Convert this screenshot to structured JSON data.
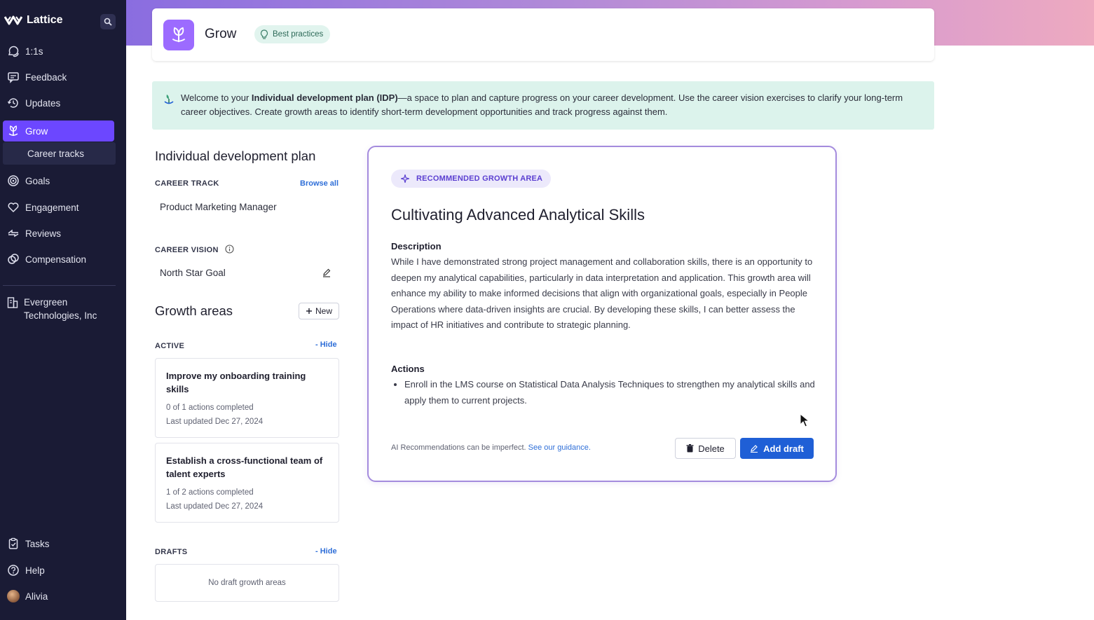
{
  "brand": {
    "name": "Lattice"
  },
  "sidebar": {
    "items": [
      {
        "label": "1:1s",
        "icon": "chat-bubbles-icon"
      },
      {
        "label": "Feedback",
        "icon": "feedback-icon"
      },
      {
        "label": "Updates",
        "icon": "updates-icon"
      },
      {
        "label": "Grow",
        "icon": "grow-icon",
        "active": true
      },
      {
        "label": "Goals",
        "icon": "target-icon"
      },
      {
        "label": "Engagement",
        "icon": "heart-icon"
      },
      {
        "label": "Reviews",
        "icon": "reviews-icon"
      },
      {
        "label": "Compensation",
        "icon": "compensation-icon"
      }
    ],
    "subitem": "Career tracks",
    "company": "Evergreen Technologies, Inc",
    "bottom": [
      {
        "label": "Tasks",
        "icon": "clipboard-icon"
      },
      {
        "label": "Help",
        "icon": "help-icon"
      },
      {
        "label": "Alivia",
        "icon": "avatar"
      }
    ]
  },
  "header": {
    "title": "Grow",
    "badge": "Best practices"
  },
  "welcome": {
    "prefix": "Welcome to your ",
    "bold": "Individual development plan (IDP)",
    "suffix": "—a space to plan and capture progress on your career development. Use the career vision exercises to clarify your long-term career objectives. Create growth areas to identify short-term development opportunities and track progress against them."
  },
  "idp": {
    "title": "Individual development plan",
    "career_track_label": "CAREER TRACK",
    "browse_all": "Browse all",
    "career_track_value": "Product Marketing Manager",
    "career_vision_label": "CAREER VISION",
    "career_vision_value": "North Star Goal"
  },
  "growth": {
    "title": "Growth areas",
    "new_button": "New",
    "active_label": "ACTIVE",
    "hide": "- Hide",
    "cards": [
      {
        "title": "Improve my onboarding training skills",
        "progress": "0 of 1 actions completed",
        "updated": "Last updated Dec 27, 2024"
      },
      {
        "title": "Establish a cross-functional team of talent experts",
        "progress": "1 of 2 actions completed",
        "updated": "Last updated Dec 27, 2024"
      }
    ],
    "drafts_label": "DRAFTS",
    "drafts_hide": "- Hide",
    "drafts_empty": "No draft growth areas"
  },
  "recommendation": {
    "badge": "RECOMMENDED GROWTH AREA",
    "title": "Cultivating Advanced Analytical Skills",
    "description_label": "Description",
    "description": "While I have demonstrated strong project management and collaboration skills, there is an opportunity to deepen my analytical capabilities, particularly in data interpretation and application. This growth area will enhance my ability to make informed decisions that align with organizational goals, especially in People Operations where data-driven insights are crucial. By developing these skills, I can better assess the impact of HR initiatives and contribute to strategic planning.",
    "actions_label": "Actions",
    "actions": [
      "Enroll in the LMS course on Statistical Data Analysis Techniques to strengthen my analytical skills and apply them to current projects."
    ],
    "disclaimer": "AI Recommendations can be imperfect.",
    "guidance_link": "See our guidance.",
    "delete_button": "Delete",
    "add_button": "Add draft"
  },
  "colors": {
    "sidebar_bg": "#1a1b35",
    "active_nav": "#6c47ff",
    "primary_button": "#1f5fd6",
    "welcome_bg": "#dcf3ec",
    "rec_border": "#a48bdd"
  }
}
